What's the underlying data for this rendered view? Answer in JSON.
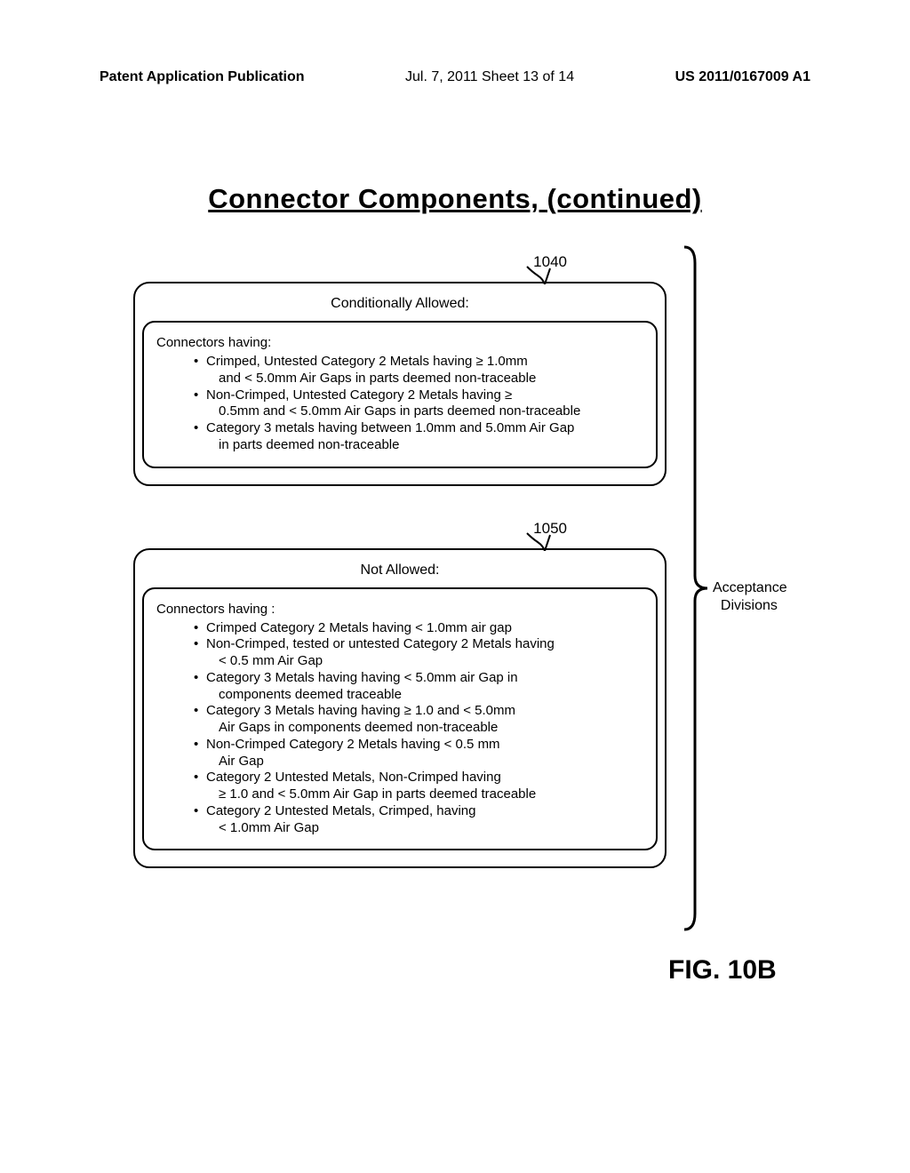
{
  "header": {
    "left": "Patent Application Publication",
    "center": "Jul. 7, 2011   Sheet 13 of 14",
    "right": "US 2011/0167009 A1"
  },
  "title": "Connector  Components, (continued)",
  "ref": {
    "r1040": "1040",
    "r1050": "1050"
  },
  "box1040": {
    "heading": "Conditionally Allowed:",
    "lead": "Connectors having:",
    "items": [
      {
        "t": "Crimped, Untested Category 2 Metals having ≥ 1.0mm",
        "c": "and < 5.0mm Air Gaps in parts deemed non-traceable"
      },
      {
        "t": "Non-Crimped, Untested Category 2 Metals having ≥",
        "c": "0.5mm and < 5.0mm Air Gaps in parts deemed non-traceable"
      },
      {
        "t": "Category 3 metals having between 1.0mm and 5.0mm Air Gap",
        "c": "in parts deemed non-traceable"
      }
    ]
  },
  "box1050": {
    "heading": "Not Allowed:",
    "lead": "Connectors having :",
    "items": [
      {
        "t": "Crimped Category 2 Metals having < 1.0mm air gap"
      },
      {
        "t": "Non-Crimped, tested or untested Category 2 Metals having",
        "c": "< 0.5 mm Air Gap"
      },
      {
        "t": "Category 3 Metals having having < 5.0mm air Gap in",
        "c": "components deemed traceable"
      },
      {
        "t": "Category 3 Metals having having ≥ 1.0 and < 5.0mm",
        "c": "Air Gaps in components deemed non-traceable"
      },
      {
        "t": "Non-Crimped Category 2 Metals having < 0.5 mm",
        "c": "Air Gap"
      },
      {
        "t": "Category 2 Untested Metals, Non-Crimped having",
        "c": "≥ 1.0 and < 5.0mm Air Gap in parts deemed traceable"
      },
      {
        "t": "Category 2 Untested Metals, Crimped, having",
        "c": "< 1.0mm Air Gap"
      }
    ]
  },
  "bracket_label_l1": "Acceptance",
  "bracket_label_l2": "Divisions",
  "figure_label": "FIG. 10B"
}
